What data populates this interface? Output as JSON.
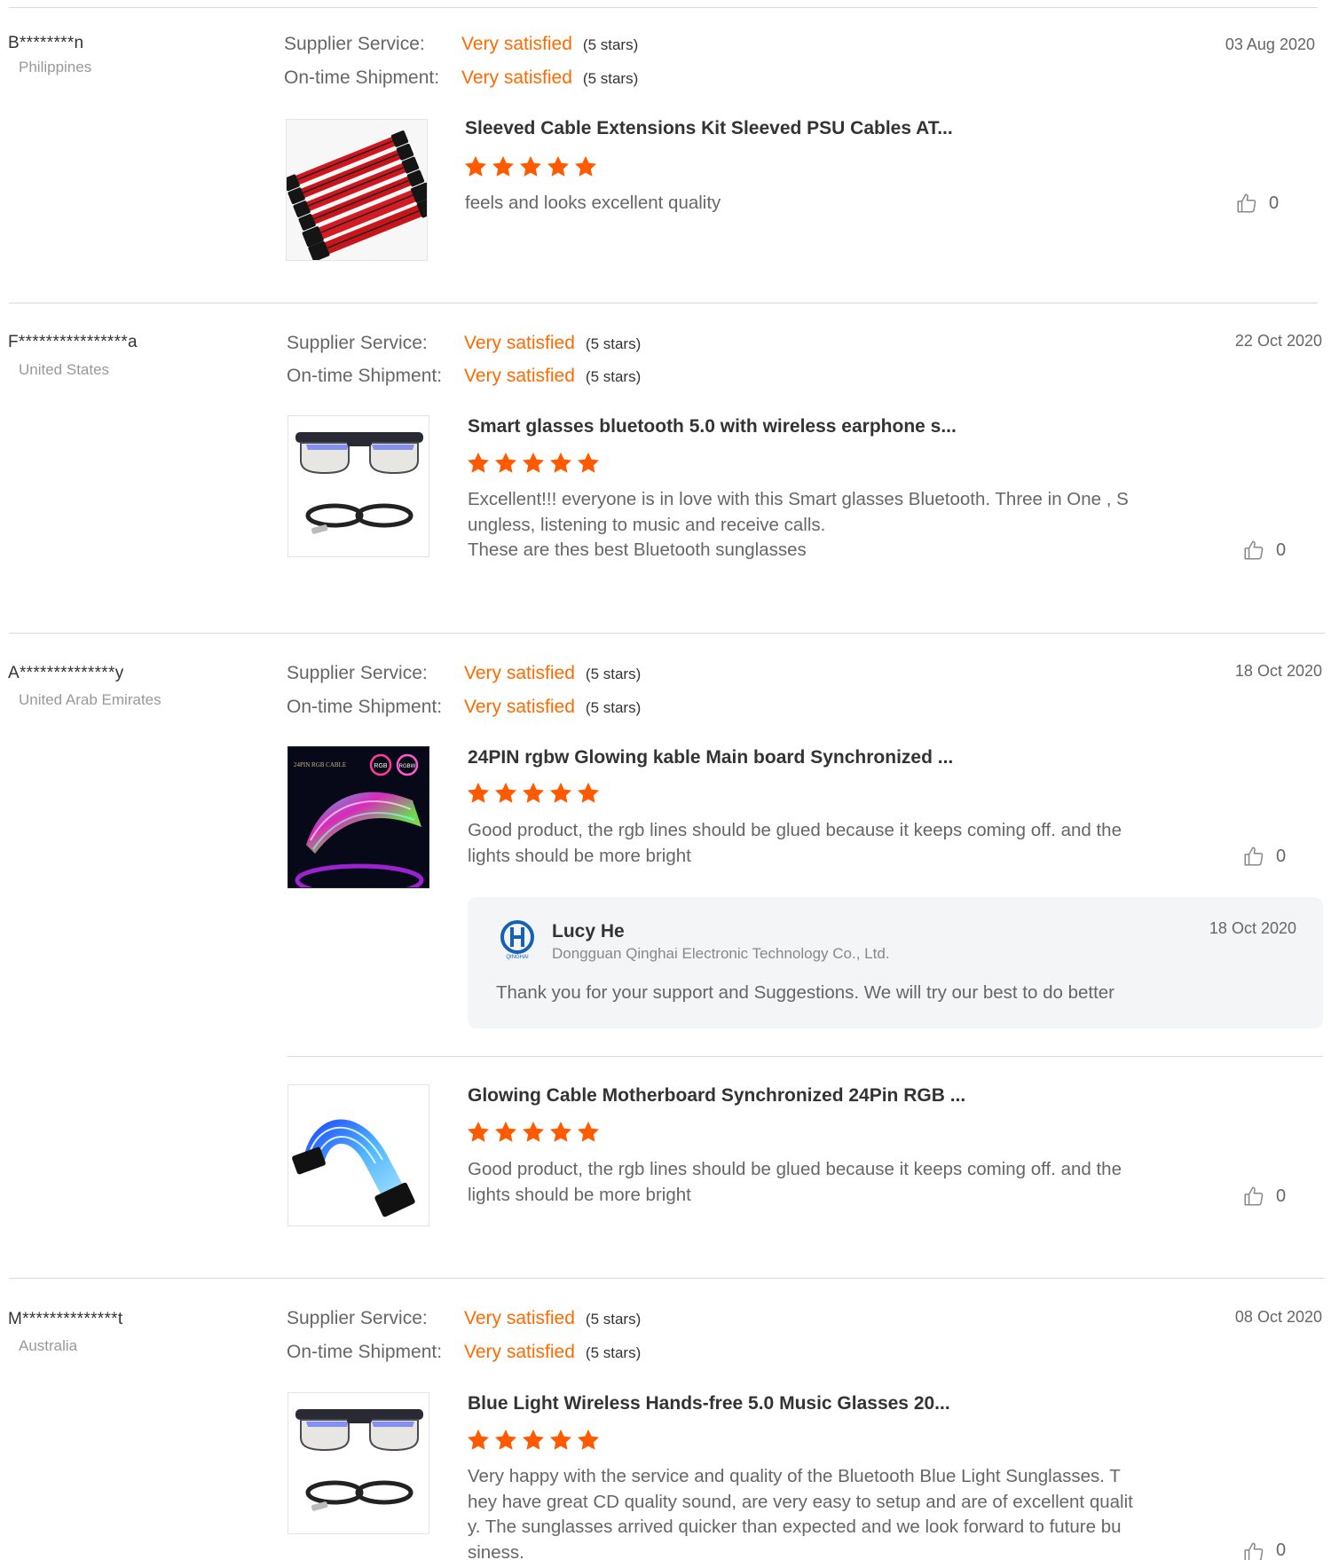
{
  "colors": {
    "accent": "#ff6a00",
    "star": "#ff5a00"
  },
  "rating_labels": {
    "supplier_service": "Supplier Service:",
    "ontime_shipment": "On-time Shipment:"
  },
  "reviews": [
    {
      "buyer": "B********n",
      "country": "Philippines",
      "date": "03 Aug 2020",
      "supplier_service": {
        "value": "Very satisfied",
        "stars": "(5 stars)"
      },
      "ontime_shipment": {
        "value": "Very satisfied",
        "stars": "(5 stars)"
      },
      "products": [
        {
          "title": "Sleeved Cable Extensions Kit Sleeved PSU Cables AT...",
          "rating": 5,
          "text": "feels and looks excellent quality",
          "likes": "0",
          "image_icon": "red-cable-kit-image"
        }
      ]
    },
    {
      "buyer": "F****************a",
      "country": "United States",
      "date": "22 Oct 2020",
      "supplier_service": {
        "value": "Very satisfied",
        "stars": "(5 stars)"
      },
      "ontime_shipment": {
        "value": "Very satisfied",
        "stars": "(5 stars)"
      },
      "products": [
        {
          "title": "Smart glasses bluetooth 5.0 with wireless earphone s...",
          "rating": 5,
          "text_lines": [
            "Excellent!!! everyone is in love with this Smart glasses Bluetooth. Three in One , S",
            "ungless, listening to music and receive calls.",
            "These are thes best Bluetooth sunglasses"
          ],
          "likes": "0",
          "image_icon": "smart-glasses-image"
        }
      ]
    },
    {
      "buyer": "A**************y",
      "country": "United Arab Emirates",
      "date": "18 Oct 2020",
      "supplier_service": {
        "value": "Very satisfied",
        "stars": "(5 stars)"
      },
      "ontime_shipment": {
        "value": "Very satisfied",
        "stars": "(5 stars)"
      },
      "products": [
        {
          "title": "24PIN rgbw Glowing kable Main board Synchronized ...",
          "rating": 5,
          "text_lines": [
            "Good product, the rgb lines should be glued because it keeps coming off.  and the",
            "lights should be more bright"
          ],
          "likes": "0",
          "image_icon": "rgb-cable-box-image",
          "image_caption": "24PIN RGB CABLE",
          "badges": [
            "RGB",
            "RGBW"
          ],
          "reply": {
            "name": "Lucy He",
            "company": "Dongguan Qinghai Electronic Technology Co., Ltd.",
            "date": "18 Oct 2020",
            "text": "Thank you for your support and Suggestions. We will try our best to do better",
            "logo_text": "QINGHAI"
          }
        },
        {
          "title": "Glowing Cable Motherboard Synchronized 24Pin RGB ...",
          "rating": 5,
          "text_lines": [
            "Good product, the rgb lines should be glued because it keeps coming off.  and the",
            "lights should be more bright"
          ],
          "likes": "0",
          "image_icon": "glowing-cable-image"
        }
      ]
    },
    {
      "buyer": "M**************t",
      "country": "Australia",
      "date": "08 Oct 2020",
      "supplier_service": {
        "value": "Very satisfied",
        "stars": "(5 stars)"
      },
      "ontime_shipment": {
        "value": "Very satisfied",
        "stars": "(5 stars)"
      },
      "products": [
        {
          "title": "Blue Light Wireless Hands-free 5.0 Music Glasses 20...",
          "rating": 5,
          "text_lines": [
            "Very happy with the service and quality of the Bluetooth Blue Light Sunglasses. T",
            "hey have great CD quality sound, are very easy to setup and are of excellent qualit",
            "y. The sunglasses arrived quicker than expected and we look forward to future bu",
            "siness."
          ],
          "likes": "0",
          "image_icon": "smart-glasses-image"
        }
      ]
    }
  ]
}
